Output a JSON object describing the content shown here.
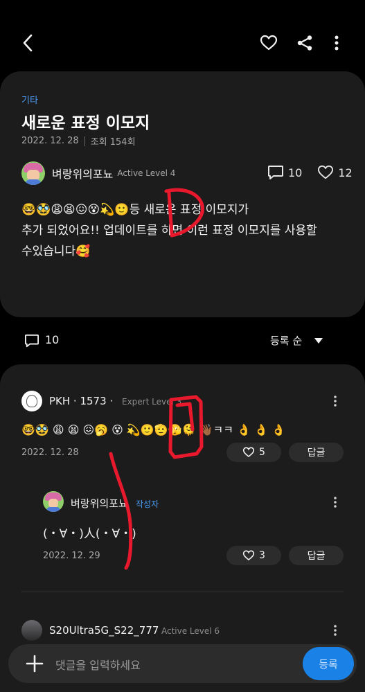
{
  "post": {
    "category": "기타",
    "title": "새로운 표정 이모지",
    "date": "2022. 12. 28",
    "views": "조회 154회",
    "author": {
      "name": "벼랑위의포뇨",
      "level": "Active Level 4"
    },
    "comment_count": "10",
    "like_count": "12",
    "body_emojis": "🤓🥸😩😫😖😵💫🙂",
    "body_line1_rest": "등 새로운 표정 이모지가",
    "body_line2": "추가 되었어요!! 업데이트를 하면 이런 표정 이모지를 사용할",
    "body_line3": "수있습니다🥰"
  },
  "comments_header": {
    "count": "10",
    "sort_label": "등록 순"
  },
  "comments": [
    {
      "name": "PKH · 1573 ·",
      "level": "Expert Level 3",
      "text": "🤓🥸 😩 😫 😖🥱 😵 💫🙂🫡🫣🫠 👋🏾ㅋㅋ 👌 👌 👌",
      "date": "2022. 12. 28",
      "likes": "5",
      "reply_label": "답글"
    },
    {
      "name": "벼랑위의포뇨",
      "author_tag": "작성자",
      "text": "(・∀・)人(・∀・)",
      "date": "2022. 12. 29",
      "likes": "3",
      "reply_label": "답글"
    },
    {
      "name": "S20Ultra5G_S22_777",
      "level": "Active Level 6"
    }
  ],
  "input": {
    "placeholder": "댓글을 입력하세요",
    "submit_label": "등록"
  },
  "annotations": {
    "drawn_letter": "D",
    "color": "#e8192c"
  },
  "colors": {
    "accent": "#4a9bf5",
    "card": "#1c1c1c",
    "submit": "#1a82e6"
  }
}
